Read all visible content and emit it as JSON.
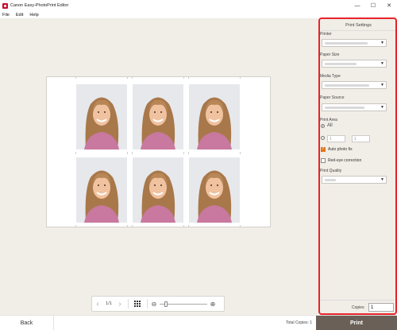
{
  "window": {
    "title": "Canon Easy-PhotoPrint Editor",
    "controls": [
      "—",
      "☐",
      "✕"
    ]
  },
  "menu": {
    "items": [
      "File",
      "Edit",
      "Help"
    ]
  },
  "print_settings": {
    "header": "Print Settings",
    "printer_label": "Printer",
    "paper_size_label": "Paper Size",
    "media_type_label": "Media Type",
    "paper_source_label": "Paper Source",
    "print_area_label": "Print Area",
    "print_area_all": "All",
    "range_from": "1",
    "range_to": "1",
    "auto_photo_fix_label": "Auto photo fix",
    "auto_photo_fix_checked": true,
    "red_eye_label": "Red-eye correction",
    "red_eye_checked": false,
    "print_quality_label": "Print Quality",
    "copies_label": "Copies",
    "copies_value": "1"
  },
  "navigation": {
    "page_indicator": "1/1",
    "prev_arrow": "‹",
    "next_arrow": "›",
    "zoom_out": "⊖",
    "zoom_in": "⊕",
    "zoom_level": 0.1
  },
  "bottom_bar": {
    "back_label": "Back",
    "total_copies": "Total Copies: 1",
    "print_label": "Print"
  },
  "colors": {
    "accent": "#e8232a",
    "print_button": "#6a6058",
    "checkbox_on": "#e0771a",
    "canvas_bg": "#f1ede7"
  },
  "photos": {
    "count": 6,
    "subject": "smiling girl portrait with long hair and pink top"
  }
}
